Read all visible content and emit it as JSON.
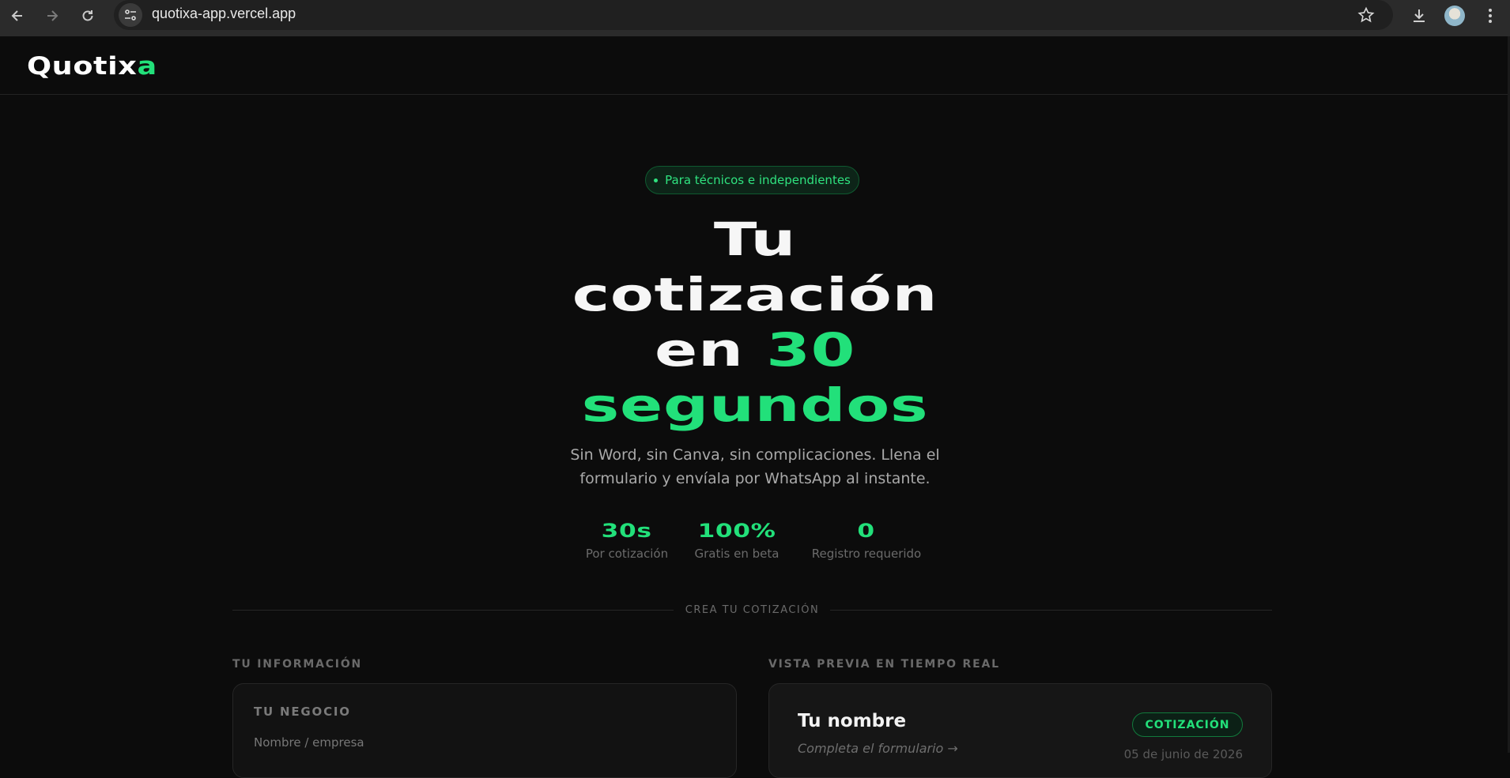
{
  "browser": {
    "url": "quotixa-app.vercel.app",
    "icons": [
      "back-arrow-icon",
      "forward-arrow-icon",
      "reload-icon",
      "site-settings-icon",
      "bookmark-star-icon",
      "download-icon",
      "profile-avatar",
      "kebab-menu-icon"
    ]
  },
  "header": {
    "logo_main": "Quotix",
    "logo_accent": "a"
  },
  "hero": {
    "pill": "Para técnicos e independientes",
    "title_line1": "Tu",
    "title_line2": "cotización",
    "title_line3_white": "en ",
    "title_line3_green": "30",
    "title_line4": "segundos",
    "subtitle": "Sin Word, sin Canva, sin complicaciones. Llena el formulario y envíala por WhatsApp al instante."
  },
  "stats": [
    {
      "value": "30s",
      "label": "Por cotización"
    },
    {
      "value": "100%",
      "label": "Gratis en beta"
    },
    {
      "value": "0",
      "label": "Registro requerido"
    }
  ],
  "divider": {
    "label": "CREA TU COTIZACIÓN"
  },
  "form": {
    "section_label": "TU INFORMACIÓN",
    "card_heading": "TU NEGOCIO",
    "field_label": "Nombre / empresa"
  },
  "preview": {
    "section_label": "VISTA PREVIA EN TIEMPO REAL",
    "name": "Tu nombre",
    "hint": "Completa el formulario →",
    "badge": "COTIZACIÓN",
    "date": "05 de junio de 2026"
  },
  "colors": {
    "accent": "#22e07a",
    "background": "#0c0c0c"
  }
}
